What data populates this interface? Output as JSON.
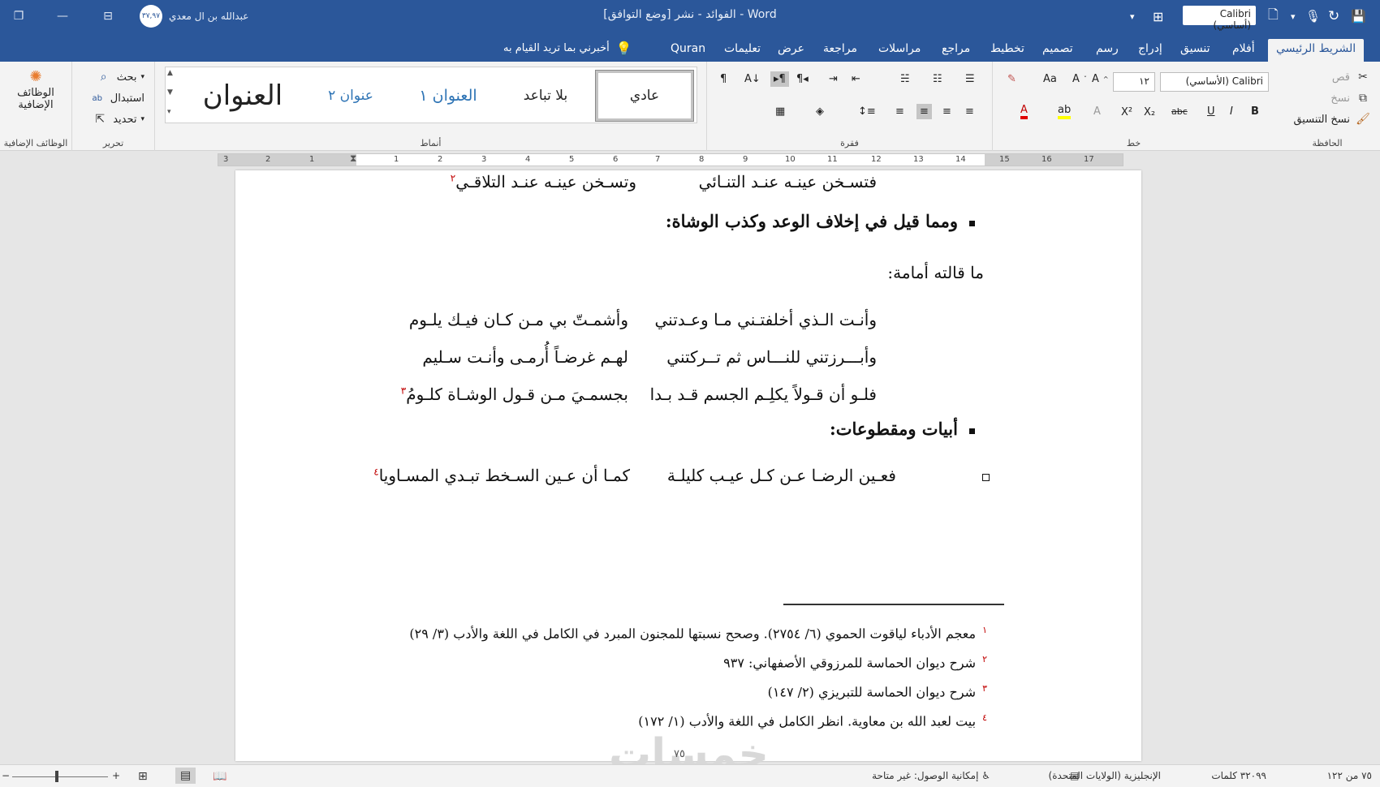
{
  "window": {
    "title": "الفوائد - نشر [وضع التوافق] - Word",
    "user_name": "عبدالله بن ال معدي",
    "avatar_text": "٣٧,٩٧",
    "font_quick": "Calibri (أساسي)"
  },
  "tabs": [
    "الشريط الرئيسي",
    "أفلام",
    "تنسيق",
    "إدراج",
    "رسم",
    "تصميم",
    "تخطيط",
    "مراجع",
    "مراسلات",
    "مراجعة",
    "عرض",
    "تعليمات",
    "Quran"
  ],
  "tellme": "أخبرني بما تريد القيام به",
  "ribbon": {
    "clipboard": {
      "label": "الحافظة",
      "cut": "قص",
      "copy": "نسخ",
      "format_painter": "نسخ التنسيق"
    },
    "font": {
      "label": "خط",
      "font_name": "Calibri (الأساسي)",
      "font_size": "١٢",
      "aa": "Aa",
      "bold": "B",
      "italic": "I",
      "underline": "U",
      "strike": "abc",
      "sub": "X₂",
      "sup": "X²"
    },
    "paragraph": {
      "label": "فقرة"
    },
    "styles": {
      "label": "أنماط",
      "items": [
        "عادي",
        "بلا تباعد",
        "العنوان ١",
        "عنوان ٢",
        "العنوان"
      ]
    },
    "editing": {
      "label": "تحرير",
      "find": "بحث",
      "replace": "استبدال",
      "select": "تحديد"
    },
    "addins": {
      "label": "الوظائف الإضافية",
      "button": "الوظائف الإضافية"
    }
  },
  "ruler": [
    "3",
    "2",
    "1",
    "1",
    "2",
    "3",
    "4",
    "5",
    "6",
    "7",
    "8",
    "9",
    "10",
    "11",
    "12",
    "13",
    "14",
    "15",
    "16",
    "17"
  ],
  "document": {
    "top_line_right": "فتسـخن عينـه عنـد التنـائي",
    "top_line_left": "وتسـخن عينـه عنـد التلاقـي",
    "top_line_ref": "٢",
    "heading1": "ومما قيل في إخلاف الوعد وكذب الوشاة:",
    "intro": "ما قالته أمامة:",
    "verses": [
      {
        "right": "وأنـت الـذي أخلفتـني مـا وعـدتني",
        "left": "وأشمـتّ بي مـن كـان فيـك يلـوم",
        "ref": ""
      },
      {
        "right": "وأبـــرزتني للنـــاس ثم تــركتني",
        "left": "لهـم غرضـاً أُرمـى وأنـت سـليم",
        "ref": ""
      },
      {
        "right": "فلـو أن قـولاً يكلِـم الجسم قـد بـدا",
        "left": "بجسمـيَ مـن قـول الوشـاة كلـومُ",
        "ref": "٣"
      }
    ],
    "heading2": "أبيات ومقطوعات:",
    "verse4_right": "فعـين الرضـا عـن كـل عيـب كليلـة",
    "verse4_left": "كمـا أن عـين السـخط تبـدي المسـاويا",
    "verse4_ref": "٤",
    "footnotes": [
      {
        "num": "١",
        "text": "معجم الأدباء لياقوت الحموي (٦/ ٢٧٥٤). وصحح نسبتها للمجنون المبرد في الكامل في اللغة والأدب (٣/ ٢٩)"
      },
      {
        "num": "٢",
        "text": "شرح ديوان الحماسة للمرزوقي الأصفهاني: ٩٣٧"
      },
      {
        "num": "٣",
        "text": "شرح ديوان الحماسة للتبريزي (٢/ ١٤٧)"
      },
      {
        "num": "٤",
        "text": "بيت لعبد الله بن معاوية. انظر الكامل في اللغة والأدب (١/ ١٧٢)"
      }
    ],
    "page_number": "٧٥",
    "watermark": "خمسات"
  },
  "status": {
    "page": "٧٥ من ١٢٢",
    "words": "٣٢٠٩٩ كلمات",
    "language": "الإنجليزية (الولايات المتحدة)",
    "accessibility": "إمكانية الوصول: غير متاحة"
  },
  "colors": {
    "accent": "#2b579a",
    "footnote_ref": "#c00000"
  }
}
